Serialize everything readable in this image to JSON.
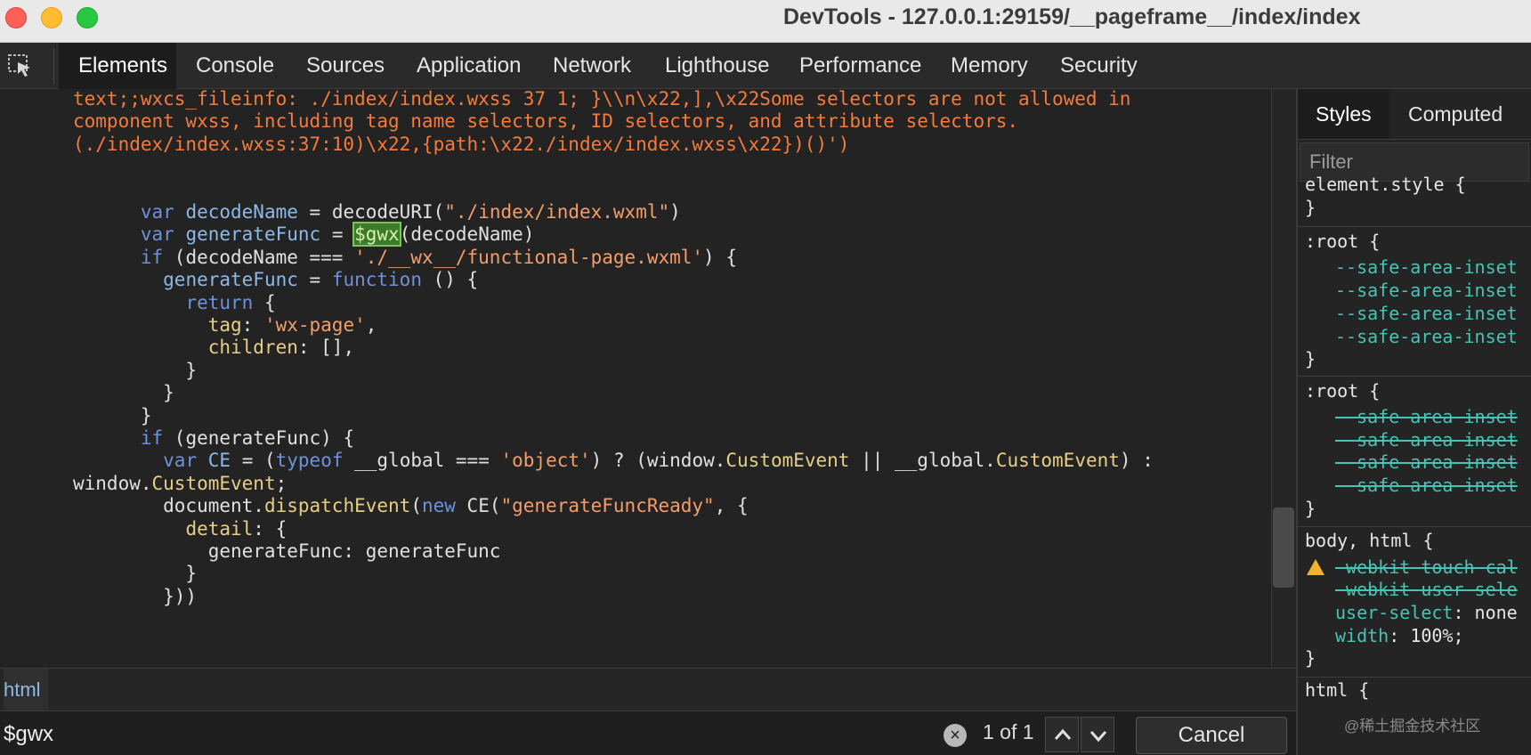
{
  "window": {
    "title": "DevTools - 127.0.0.1:29159/__pageframe__/index/index"
  },
  "tabs": [
    {
      "label": "Elements",
      "active": true
    },
    {
      "label": "Console"
    },
    {
      "label": "Sources"
    },
    {
      "label": "Application"
    },
    {
      "label": "Network"
    },
    {
      "label": "Lighthouse"
    },
    {
      "label": "Performance"
    },
    {
      "label": "Memory"
    },
    {
      "label": "Security"
    }
  ],
  "code": {
    "lines": [
      "text;;wxcs_fileinfo: ./index/index.wxss 37 1; }\\\\n\\x22,],\\x22Some selectors are not allowed in",
      "component wxss, including tag name selectors, ID selectors, and attribute selectors.",
      "(./index/index.wxss:37:10)\\x22,{path:\\x22./index/index.wxss\\x22})()')",
      "",
      "",
      "      var decodeName = decodeURI(\"./index/index.wxml\")",
      "      var generateFunc = $gwx(decodeName)",
      "      if (decodeName === './__wx__/functional-page.wxml') {",
      "        generateFunc = function () {",
      "          return {",
      "            tag: 'wx-page',",
      "            children: [],",
      "          }",
      "        }",
      "      }",
      "      if (generateFunc) {",
      "        var CE = (typeof __global === 'object') ? (window.CustomEvent || __global.CustomEvent) :",
      "window.CustomEvent;",
      "        document.dispatchEvent(new CE(\"generateFuncReady\", {",
      "          detail: {",
      "            generateFunc: generateFunc",
      "          }",
      "        }))"
    ]
  },
  "breadcrumb": {
    "item": "html"
  },
  "search": {
    "value": "$gwx",
    "match_count": "1 of 1",
    "cancel_label": "Cancel",
    "clear_icon": "×"
  },
  "styles_panel": {
    "tabs": [
      {
        "label": "Styles",
        "active": true
      },
      {
        "label": "Computed"
      }
    ],
    "filter_placeholder": "Filter",
    "rules": {
      "element_style_open": "element.style {",
      "close": "}",
      "root_open": ":root {",
      "safe_area_prop": "--safe-area-inset",
      "body_html_open": "body, html {",
      "webkit_touch": "-webkit-touch-cal",
      "webkit_user": "-webkit-user-sele",
      "user_select_prop": "user-select",
      "user_select_val": "none",
      "width_prop": "width",
      "width_val": "100%;",
      "html_open": "html {"
    }
  },
  "watermark": "@稀土掘金技术社区",
  "colors": {
    "keyword": "#6f91d8",
    "string": "#f29d6b",
    "highlight": "#3d7a2a",
    "css_property": "#46c4b5"
  }
}
